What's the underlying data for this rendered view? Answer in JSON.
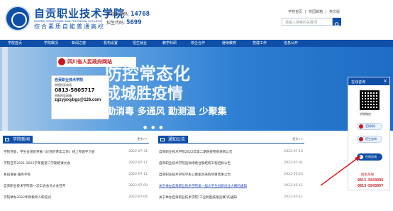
{
  "header": {
    "school_name": "自贡职业技术学院",
    "school_en": "ZIGONG VOCATIONAL AND TECHNICAL COLLEGE",
    "slogan": "综合素质自能普通高校",
    "code_label": "学校标识码:",
    "code_value": "14768",
    "enroll_label": "招生代码:",
    "enroll_value": "5699",
    "top_links": [
      "学校首页",
      "|",
      "校园邮箱",
      "|",
      "英文版"
    ],
    "search_placeholder": "请输入搜索的关键词"
  },
  "nav": {
    "items": [
      "学院首页",
      "学院概况",
      "新闻之窗",
      "机构设置",
      "招生就业",
      "教学科研",
      "校企合作",
      "继续教育",
      "党建工作",
      "信息公开"
    ]
  },
  "banner": {
    "gov_badge": "四川省人民政府网站",
    "title": "防控常态化",
    "subtitle": "成城胜疫情",
    "slogan": "勤消毒  多通风  勤测温  少聚集",
    "dots": "● ● ●",
    "report_card": {
      "title": "自贡职业技术学院",
      "phone_label": "举报投诉电话:",
      "phone": "0813-5805717",
      "email_label": "举报投诉邮箱:",
      "email": "zgzyjsxybgs@126.com"
    }
  },
  "sections": {
    "left": {
      "title": "学院新闻",
      "more": "更多>>",
      "items": [
        {
          "title": "学院党委、学生会组织开展《论党的青年工作》线上专题学习会",
          "date": "2022-07-31"
        },
        {
          "title": "学院召开2021-2022学年度第二学期结课大会",
          "date": "2022-07-11"
        },
        {
          "title": "易班发展 服务学生",
          "date": "2022-07-11"
        },
        {
          "title": "自贡职业技术学院第一次工会会员大会召开",
          "date": "2022-07-09"
        },
        {
          "title": "学院举办2022年新教师入职培训",
          "date": "2022-07-06"
        }
      ]
    },
    "right": {
      "title": "通知公告",
      "more": "更多>>",
      "items": [
        {
          "title": "自贡职业技术学院2022年第二期防疫物资采购公告",
          "date": "2022-07-15"
        },
        {
          "title": "自贡职业技术学院运动场看台钢结构工程招标公告",
          "date": "2022-07-01"
        },
        {
          "title": "自贡职业技术学院学生公寓家具采购项目结果公告",
          "date": "2022-05-24"
        },
        {
          "title": "关于举办自贡职业技术学院第一届大学生创新创业大赛的通知",
          "date": "2022-05-11",
          "highlight": true
        },
        {
          "title": "关于举办自贡职业技术学院\"工业制图技能竞赛\"的通知",
          "date": "2022-05-11"
        }
      ]
    }
  },
  "float": {
    "title": "在线咨询",
    "close": "×",
    "qr_caption": "学院微信",
    "buttons": [
      {
        "label": "官网QQ",
        "active": false
      },
      {
        "label": "招生咨询",
        "active": false
      },
      {
        "label": "在线咨询",
        "active": true
      }
    ],
    "phone_label": "招生热线",
    "phones": [
      "0813-5843998",
      "0813-5843997"
    ]
  },
  "colors": {
    "brand": "#0f4fa8",
    "accent_red": "#c8161d"
  }
}
